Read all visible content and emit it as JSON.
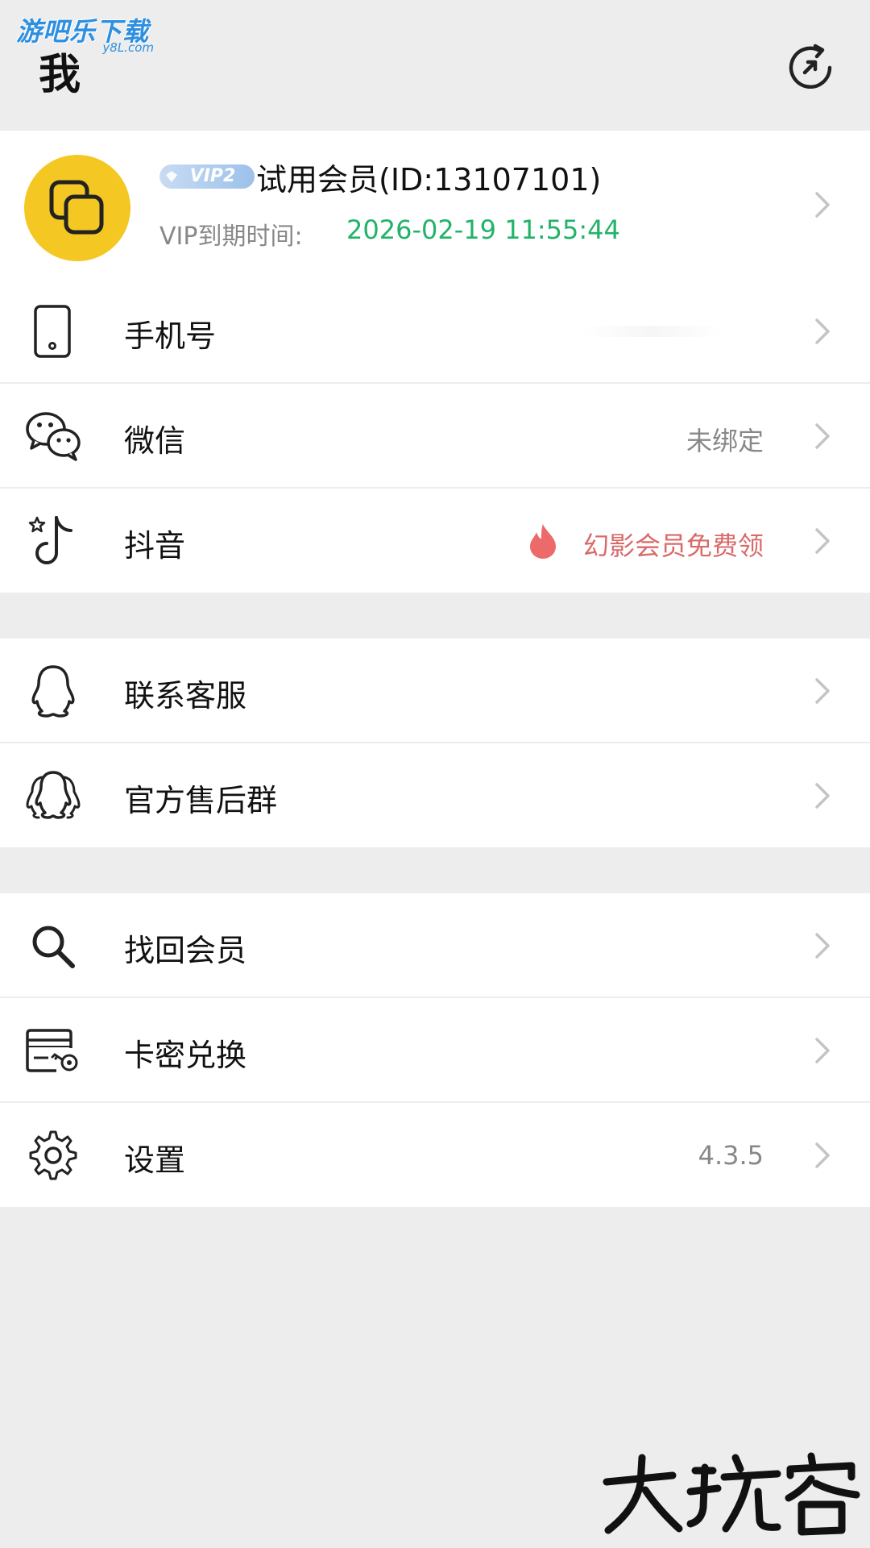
{
  "watermark": {
    "main": "游吧乐下载",
    "sub": "y8L.com"
  },
  "header": {
    "title": "我"
  },
  "profile": {
    "vip_badge": "VIP2",
    "name": "试用会员(ID:13107101)",
    "expire_label": "VIP到期时间:",
    "expire_value": "2026-02-19 11:55:44"
  },
  "menu_group_1": [
    {
      "icon": "phone-icon",
      "label": "手机号",
      "value": ""
    },
    {
      "icon": "wechat-icon",
      "label": "微信",
      "value": "未绑定"
    },
    {
      "icon": "douyin-icon",
      "label": "抖音",
      "value": "幻影会员免费领"
    }
  ],
  "menu_group_2": [
    {
      "icon": "qq-icon",
      "label": "联系客服"
    },
    {
      "icon": "qq-group-icon",
      "label": "官方售后群"
    }
  ],
  "menu_group_3": [
    {
      "icon": "search-icon",
      "label": "找回会员"
    },
    {
      "icon": "card-key-icon",
      "label": "卡密兑换"
    },
    {
      "icon": "gear-icon",
      "label": "设置",
      "value": "4.3.5"
    }
  ],
  "signature": "大玩客",
  "colors": {
    "background": "#ededed",
    "avatar": "#f5c722",
    "expire_green": "#21b36a",
    "promo_red": "#d96a6a",
    "vip_badge": "#9cc1ea",
    "watermark_blue": "#2d8fe0"
  }
}
